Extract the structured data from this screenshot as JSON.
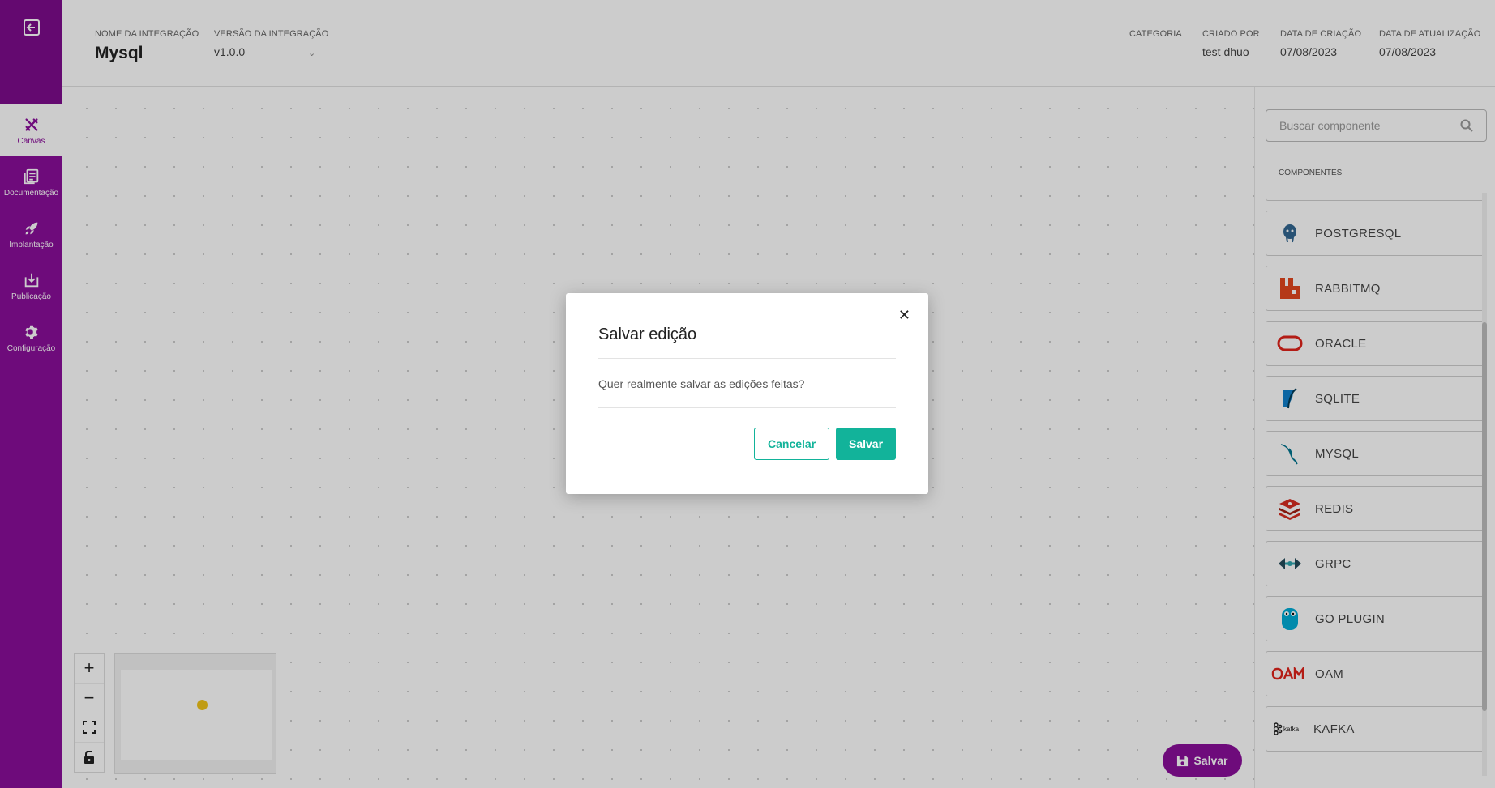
{
  "header": {
    "name_label": "NOME DA INTEGRAÇÃO",
    "name_value": "Mysql",
    "version_label": "VERSÃO DA INTEGRAÇÃO",
    "version_value": "v1.0.0",
    "category_label": "CATEGORIA",
    "created_by_label": "CRIADO POR",
    "created_by_value": "test dhuo",
    "created_date_label": "DATA DE CRIAÇÃO",
    "created_date_value": "07/08/2023",
    "updated_date_label": "DATA DE ATUALIZAÇÃO",
    "updated_date_value": "07/08/2023"
  },
  "sidebar": {
    "items": [
      {
        "label": "Canvas",
        "icon": "tools-icon"
      },
      {
        "label": "Documentação",
        "icon": "document-icon"
      },
      {
        "label": "Implantação",
        "icon": "rocket-icon"
      },
      {
        "label": "Publicação",
        "icon": "publish-icon"
      },
      {
        "label": "Configuração",
        "icon": "gear-icon"
      }
    ]
  },
  "panel": {
    "search_placeholder": "Buscar componente",
    "components_label": "COMPONENTES",
    "components": [
      {
        "name": "POSTGRESQL",
        "color": "#336791"
      },
      {
        "name": "RABBITMQ",
        "color": "#e3461f"
      },
      {
        "name": "ORACLE",
        "color": "#e0231b"
      },
      {
        "name": "SQLITE",
        "color": "#0f80cc"
      },
      {
        "name": "MYSQL",
        "color": "#00758f"
      },
      {
        "name": "REDIS",
        "color": "#d82c20"
      },
      {
        "name": "GRPC",
        "color": "#244c5a"
      },
      {
        "name": "GO PLUGIN",
        "color": "#00add8"
      },
      {
        "name": "OAM",
        "color": "#e0231b"
      },
      {
        "name": "KAFKA",
        "color": "#222222"
      }
    ]
  },
  "canvas": {
    "save_label": "Salvar"
  },
  "modal": {
    "title": "Salvar edição",
    "message": "Quer realmente salvar as edições feitas?",
    "cancel_label": "Cancelar",
    "save_label": "Salvar"
  },
  "colors": {
    "brand": "#8a0e9a",
    "accent": "#12b39a"
  }
}
